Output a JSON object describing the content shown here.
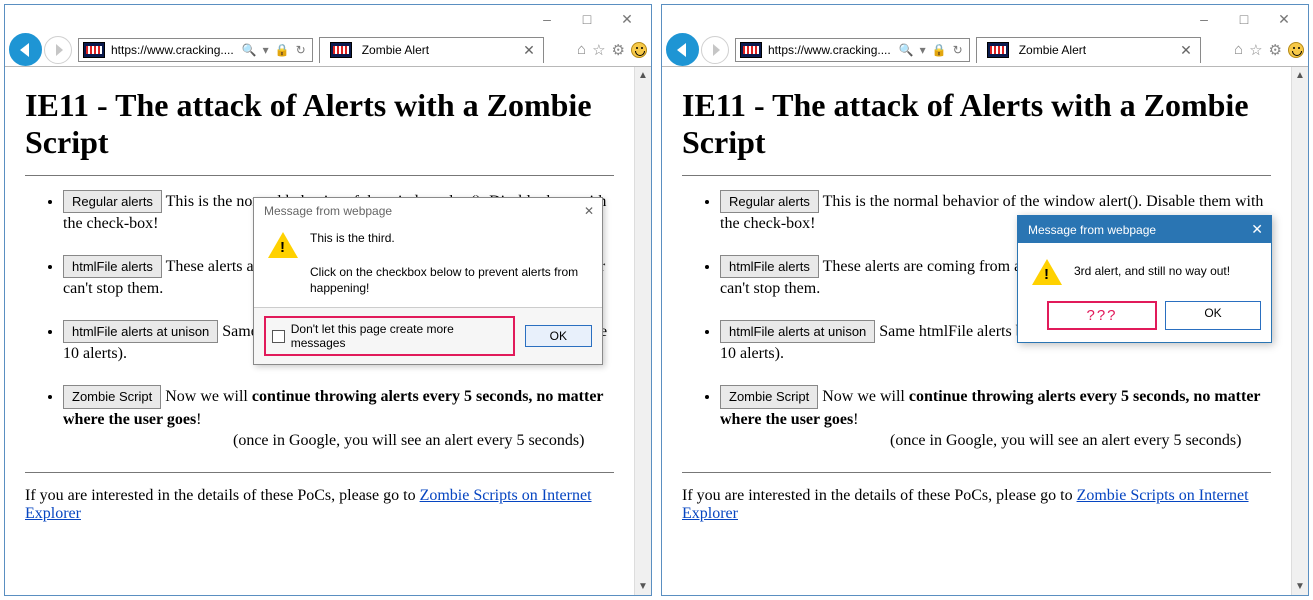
{
  "window": {
    "url": "https://www.cracking....",
    "tab_title": "Zombie Alert"
  },
  "page": {
    "h1": "IE11 - The attack of Alerts with a Zombie Script",
    "items": [
      {
        "btn": "Regular alerts",
        "text_a": " This is the normal behavior of the window alert(). Disable them with the check-box!"
      },
      {
        "btn": "htmlFile alerts",
        "text_a": " These alerts are coming from an htmlFile (ActiveXObject). The user can't stop them."
      },
      {
        "btn": "htmlFile alerts at unison",
        "text_a": " Same htmlFile alerts but in a loop (so you will have to close 10 alerts)."
      },
      {
        "btn": "Zombie Script",
        "text_a": " Now we will ",
        "bold": "continue throwing alerts every 5 seconds, no matter where the user goes",
        "after": "!",
        "note": "(once in Google, you will see an alert every 5 seconds)"
      }
    ],
    "footer_a": "If you are interested in the details of these PoCs, please go to ",
    "footer_link": "Zombie Scripts on Internet Explorer"
  },
  "dlg1": {
    "title": "Message from webpage",
    "line1": "This is the third.",
    "line2": "Click on the checkbox below to prevent alerts from happening!",
    "checkbox": "Don't let this page create more messages",
    "ok": "OK"
  },
  "dlg2": {
    "title": "Message from webpage",
    "msg": "3rd alert, and still no way out!",
    "placeholder": "???",
    "ok": "OK"
  }
}
